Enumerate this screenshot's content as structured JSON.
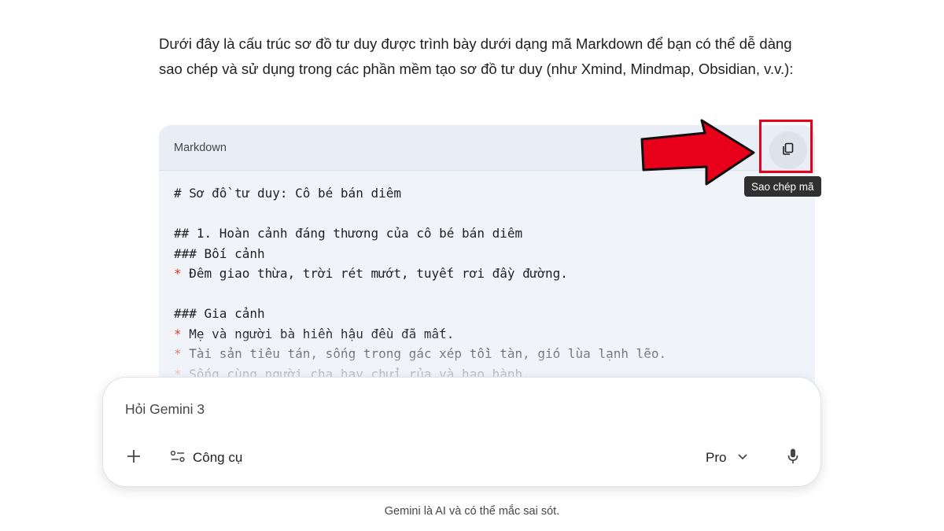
{
  "intro": {
    "text": "Dưới đây là cấu trúc sơ đồ tư duy được trình bày dưới dạng mã Markdown để bạn có thể dễ dàng sao chép và sử dụng trong các phần mềm tạo sơ đồ tư duy (như Xmind, Mindmap, Obsidian, v.v.):"
  },
  "code_block": {
    "language": "Markdown",
    "copy_icon": "copy-icon",
    "copy_tooltip": "Sao chép mã",
    "lines": [
      {
        "marker": "",
        "text": "# Sơ đồ tư duy: Cô bé bán diêm"
      },
      {
        "marker": "",
        "text": ""
      },
      {
        "marker": "",
        "text": "## 1. Hoàn cảnh đáng thương của cô bé bán diêm"
      },
      {
        "marker": "",
        "text": "### Bối cảnh"
      },
      {
        "marker": "*",
        "text": " Đêm giao thừa, trời rét mướt, tuyết rơi đầy đường."
      },
      {
        "marker": "",
        "text": ""
      },
      {
        "marker": "",
        "text": "### Gia cảnh"
      },
      {
        "marker": "*",
        "text": " Mẹ và người bà hiền hậu đều đã mất."
      },
      {
        "marker": "*",
        "text": " Tài sản tiêu tán, sống trong gác xép tồi tàn, gió lùa lạnh lẽo."
      },
      {
        "marker": "*",
        "text": " Sống cùng người cha hay chửi rủa và hạo hành."
      }
    ]
  },
  "annotation": {
    "arrow_color": "#e8001a",
    "highlight_color": "#e8001a"
  },
  "composer": {
    "placeholder": "Hỏi Gemini 3",
    "add_icon": "plus-icon",
    "tools_icon": "tools-sliders-icon",
    "tools_label": "Công cụ",
    "model_label": "Pro",
    "model_icon": "chevron-down-icon",
    "mic_icon": "microphone-icon"
  },
  "footer": {
    "disclaimer": "Gemini là AI và có thể mắc sai sót."
  }
}
